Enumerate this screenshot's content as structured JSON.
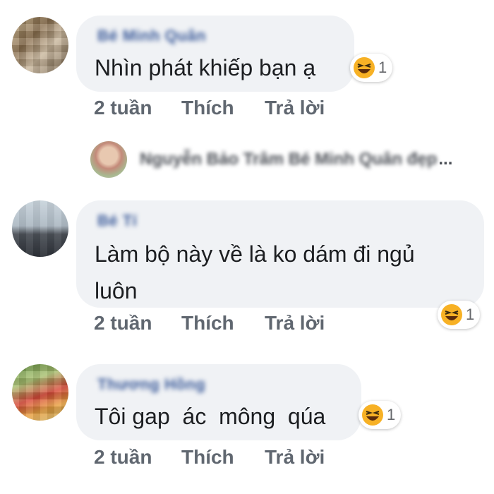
{
  "comments": [
    {
      "author": "Bé Minh Quân",
      "text": "Nhìn phát khiếp bạn ạ",
      "reaction": {
        "emoji": "laughing-emoji",
        "count": "1"
      },
      "time": "2 tuần",
      "like_label": "Thích",
      "reply_label": "Trả lời"
    },
    {
      "author": "Bé Tí",
      "text": "Làm bộ này về là ko dám đi ngủ\nluôn",
      "reaction": {
        "emoji": "laughing-emoji",
        "count": "1"
      },
      "time": "2 tuần",
      "like_label": "Thích",
      "reply_label": "Trả lời"
    },
    {
      "author": "Thương Hồng",
      "text": "Tôi gap  ác  mông  qúa",
      "reaction": {
        "emoji": "laughing-emoji",
        "count": "1"
      },
      "time": "2 tuần",
      "like_label": "Thích",
      "reply_label": "Trả lời"
    }
  ],
  "reply_preview": {
    "text": "Nguyễn Bảo Trâm Bé Minh Quân đẹp",
    "ellipsis": "..."
  },
  "colors": {
    "bubble": "#f0f2f5",
    "author": "#385898",
    "meta": "#606770",
    "emoji_face": "#f7b125"
  }
}
